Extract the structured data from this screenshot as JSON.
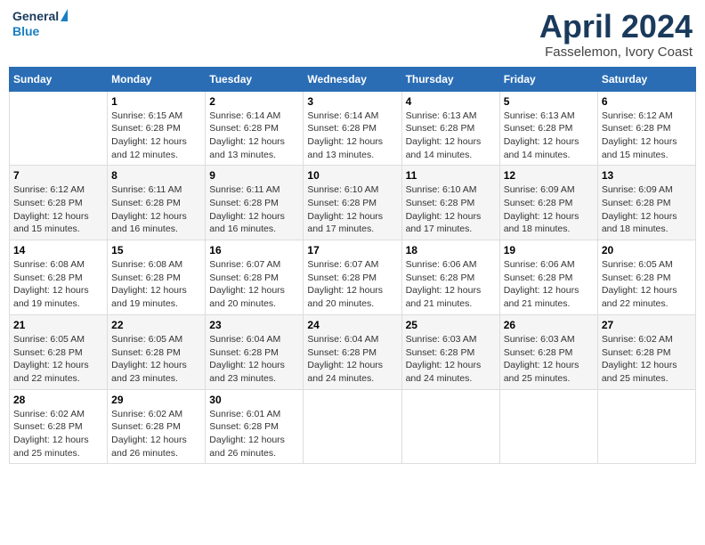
{
  "logo": {
    "general": "General",
    "blue": "Blue"
  },
  "header": {
    "month": "April 2024",
    "location": "Fasselemon, Ivory Coast"
  },
  "days_of_week": [
    "Sunday",
    "Monday",
    "Tuesday",
    "Wednesday",
    "Thursday",
    "Friday",
    "Saturday"
  ],
  "weeks": [
    [
      {
        "day": "",
        "info": ""
      },
      {
        "day": "1",
        "info": "Sunrise: 6:15 AM\nSunset: 6:28 PM\nDaylight: 12 hours\nand 12 minutes."
      },
      {
        "day": "2",
        "info": "Sunrise: 6:14 AM\nSunset: 6:28 PM\nDaylight: 12 hours\nand 13 minutes."
      },
      {
        "day": "3",
        "info": "Sunrise: 6:14 AM\nSunset: 6:28 PM\nDaylight: 12 hours\nand 13 minutes."
      },
      {
        "day": "4",
        "info": "Sunrise: 6:13 AM\nSunset: 6:28 PM\nDaylight: 12 hours\nand 14 minutes."
      },
      {
        "day": "5",
        "info": "Sunrise: 6:13 AM\nSunset: 6:28 PM\nDaylight: 12 hours\nand 14 minutes."
      },
      {
        "day": "6",
        "info": "Sunrise: 6:12 AM\nSunset: 6:28 PM\nDaylight: 12 hours\nand 15 minutes."
      }
    ],
    [
      {
        "day": "7",
        "info": "Sunrise: 6:12 AM\nSunset: 6:28 PM\nDaylight: 12 hours\nand 15 minutes."
      },
      {
        "day": "8",
        "info": "Sunrise: 6:11 AM\nSunset: 6:28 PM\nDaylight: 12 hours\nand 16 minutes."
      },
      {
        "day": "9",
        "info": "Sunrise: 6:11 AM\nSunset: 6:28 PM\nDaylight: 12 hours\nand 16 minutes."
      },
      {
        "day": "10",
        "info": "Sunrise: 6:10 AM\nSunset: 6:28 PM\nDaylight: 12 hours\nand 17 minutes."
      },
      {
        "day": "11",
        "info": "Sunrise: 6:10 AM\nSunset: 6:28 PM\nDaylight: 12 hours\nand 17 minutes."
      },
      {
        "day": "12",
        "info": "Sunrise: 6:09 AM\nSunset: 6:28 PM\nDaylight: 12 hours\nand 18 minutes."
      },
      {
        "day": "13",
        "info": "Sunrise: 6:09 AM\nSunset: 6:28 PM\nDaylight: 12 hours\nand 18 minutes."
      }
    ],
    [
      {
        "day": "14",
        "info": "Sunrise: 6:08 AM\nSunset: 6:28 PM\nDaylight: 12 hours\nand 19 minutes."
      },
      {
        "day": "15",
        "info": "Sunrise: 6:08 AM\nSunset: 6:28 PM\nDaylight: 12 hours\nand 19 minutes."
      },
      {
        "day": "16",
        "info": "Sunrise: 6:07 AM\nSunset: 6:28 PM\nDaylight: 12 hours\nand 20 minutes."
      },
      {
        "day": "17",
        "info": "Sunrise: 6:07 AM\nSunset: 6:28 PM\nDaylight: 12 hours\nand 20 minutes."
      },
      {
        "day": "18",
        "info": "Sunrise: 6:06 AM\nSunset: 6:28 PM\nDaylight: 12 hours\nand 21 minutes."
      },
      {
        "day": "19",
        "info": "Sunrise: 6:06 AM\nSunset: 6:28 PM\nDaylight: 12 hours\nand 21 minutes."
      },
      {
        "day": "20",
        "info": "Sunrise: 6:05 AM\nSunset: 6:28 PM\nDaylight: 12 hours\nand 22 minutes."
      }
    ],
    [
      {
        "day": "21",
        "info": "Sunrise: 6:05 AM\nSunset: 6:28 PM\nDaylight: 12 hours\nand 22 minutes."
      },
      {
        "day": "22",
        "info": "Sunrise: 6:05 AM\nSunset: 6:28 PM\nDaylight: 12 hours\nand 23 minutes."
      },
      {
        "day": "23",
        "info": "Sunrise: 6:04 AM\nSunset: 6:28 PM\nDaylight: 12 hours\nand 23 minutes."
      },
      {
        "day": "24",
        "info": "Sunrise: 6:04 AM\nSunset: 6:28 PM\nDaylight: 12 hours\nand 24 minutes."
      },
      {
        "day": "25",
        "info": "Sunrise: 6:03 AM\nSunset: 6:28 PM\nDaylight: 12 hours\nand 24 minutes."
      },
      {
        "day": "26",
        "info": "Sunrise: 6:03 AM\nSunset: 6:28 PM\nDaylight: 12 hours\nand 25 minutes."
      },
      {
        "day": "27",
        "info": "Sunrise: 6:02 AM\nSunset: 6:28 PM\nDaylight: 12 hours\nand 25 minutes."
      }
    ],
    [
      {
        "day": "28",
        "info": "Sunrise: 6:02 AM\nSunset: 6:28 PM\nDaylight: 12 hours\nand 25 minutes."
      },
      {
        "day": "29",
        "info": "Sunrise: 6:02 AM\nSunset: 6:28 PM\nDaylight: 12 hours\nand 26 minutes."
      },
      {
        "day": "30",
        "info": "Sunrise: 6:01 AM\nSunset: 6:28 PM\nDaylight: 12 hours\nand 26 minutes."
      },
      {
        "day": "",
        "info": ""
      },
      {
        "day": "",
        "info": ""
      },
      {
        "day": "",
        "info": ""
      },
      {
        "day": "",
        "info": ""
      }
    ]
  ]
}
